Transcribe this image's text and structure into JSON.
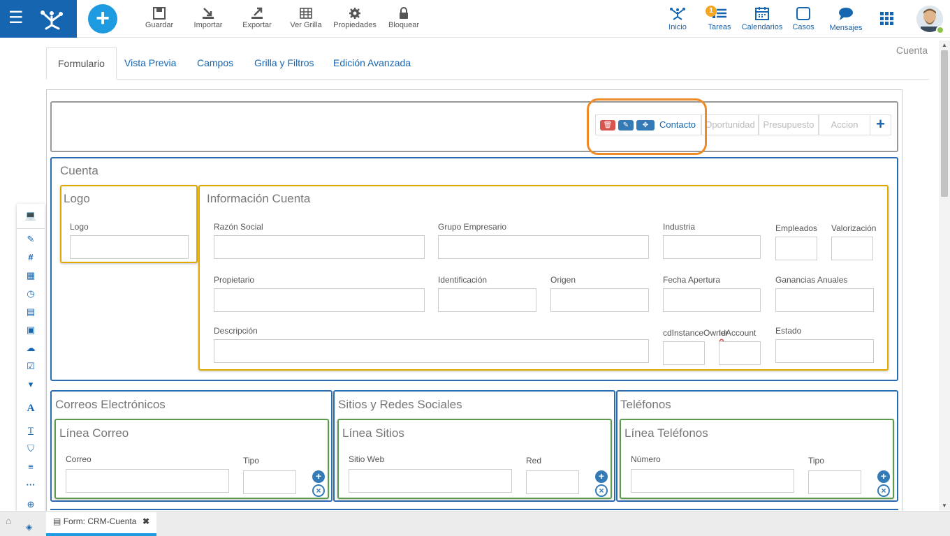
{
  "topbar": {
    "tools": [
      {
        "label": "Guardar",
        "icon": "save-icon"
      },
      {
        "label": "Importar",
        "icon": "import-icon"
      },
      {
        "label": "Exportar",
        "icon": "export-icon"
      },
      {
        "label": "Ver Grilla",
        "icon": "grid-icon"
      },
      {
        "label": "Propiedades",
        "icon": "gear-icon"
      },
      {
        "label": "Bloquear",
        "icon": "lock-icon"
      }
    ],
    "right": [
      {
        "label": "Inicio",
        "icon": "home-network-icon"
      },
      {
        "label": "Tareas",
        "icon": "tasks-icon",
        "badge": "1"
      },
      {
        "label": "Calendarios",
        "icon": "calendar-icon"
      },
      {
        "label": "Casos",
        "icon": "cases-icon"
      },
      {
        "label": "Mensajes",
        "icon": "chat-icon"
      }
    ]
  },
  "entity_title": "Cuenta",
  "tabs": [
    "Formulario",
    "Vista Previa",
    "Campos",
    "Grilla y Filtros",
    "Edición Avanzada"
  ],
  "tabstrip": {
    "items": [
      "Contacto",
      "Oportunidad",
      "Presupuesto",
      "Accion"
    ],
    "plus": "+"
  },
  "cuenta": {
    "title": "Cuenta",
    "logo_box": {
      "title": "Logo",
      "field": "Logo"
    },
    "info": {
      "title": "Información Cuenta",
      "fields": {
        "razon": "Razón Social",
        "grupo": "Grupo Empresario",
        "industria": "Industria",
        "empleados": "Empleados",
        "valorizacion": "Valorización",
        "propietario": "Propietario",
        "identificacion": "Identificación",
        "origen": "Origen",
        "fecha": "Fecha Apertura",
        "ganancias": "Ganancias Anuales",
        "descripcion": "Descripción",
        "cdinstance": "cdInstanceOwner",
        "idaccount": "IdAccount",
        "estado": "Estado"
      }
    }
  },
  "correos": {
    "title": "Correos Electrónicos",
    "line": "Línea Correo",
    "f1": "Correo",
    "f2": "Tipo"
  },
  "sitios": {
    "title": "Sitios y Redes Sociales",
    "line": "Línea Sitios",
    "f1": "Sitio Web",
    "f2": "Red"
  },
  "telefonos": {
    "title": "Teléfonos",
    "line": "Línea Teléfonos",
    "f1": "Número",
    "f2": "Tipo"
  },
  "bottom": {
    "tab_label": "Form: CRM-Cuenta"
  },
  "colors": {
    "brand": "#1565b0",
    "accent": "#1e9be0",
    "highlight": "#f08a24",
    "section_blue": "#2b6cb0",
    "gold": "#e0a700",
    "green": "#5a9a4a"
  }
}
